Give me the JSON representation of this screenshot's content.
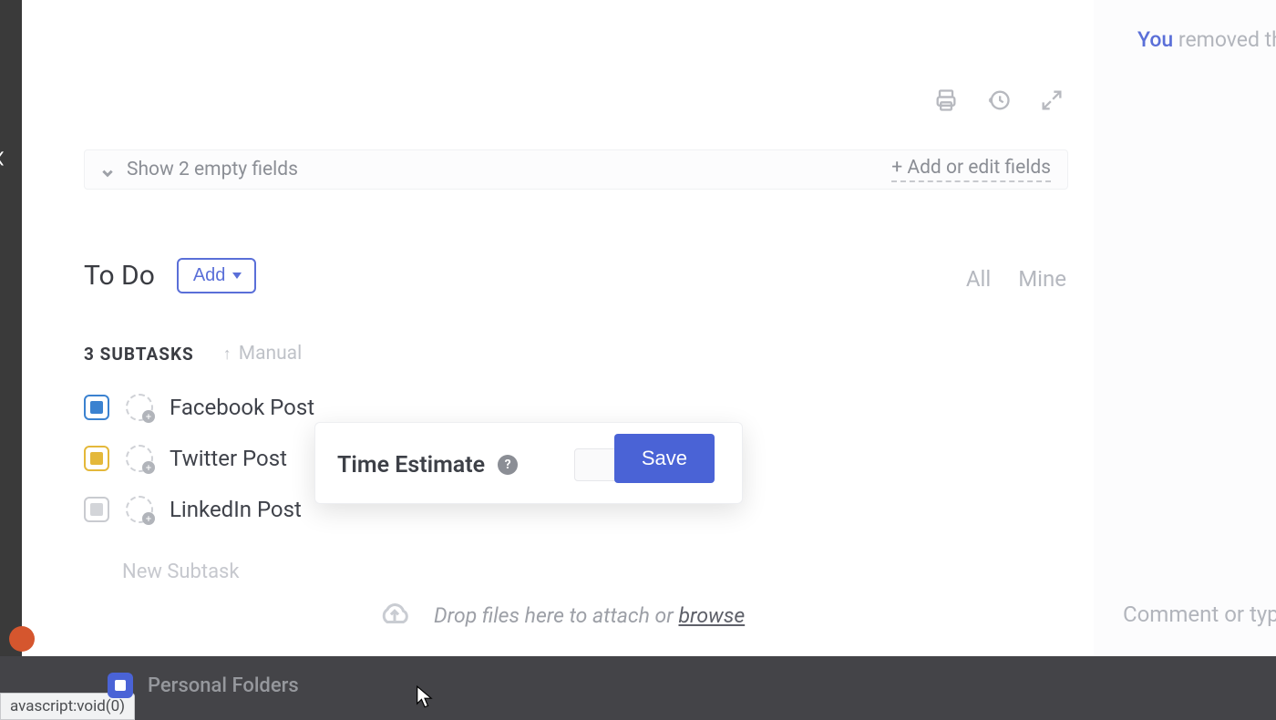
{
  "fields_bar": {
    "show_text": "Show 2 empty fields",
    "add_edit": "+ Add or edit fields"
  },
  "todo": {
    "title": "To Do",
    "add_label": "Add",
    "filters": {
      "all": "All",
      "mine": "Mine"
    }
  },
  "subtasks": {
    "count_label": "3 SUBTASKS",
    "sort_label": "Manual",
    "items": [
      {
        "name": "Facebook Post",
        "status": "blue"
      },
      {
        "name": "Twitter Post",
        "status": "yellow"
      },
      {
        "name": "LinkedIn Post",
        "status": "gray"
      }
    ],
    "new_placeholder": "New Subtask"
  },
  "popover": {
    "label": "Time Estimate",
    "input_value": "",
    "save_label": "Save"
  },
  "attach": {
    "text": "Drop files here to attach or ",
    "browse": "browse"
  },
  "activity": {
    "you": "You",
    "rest": " removed th"
  },
  "comment_placeholder": "Comment or typ",
  "bottom": {
    "status_link": "avascript:void(0)",
    "personal_folders": "Personal Folders"
  }
}
